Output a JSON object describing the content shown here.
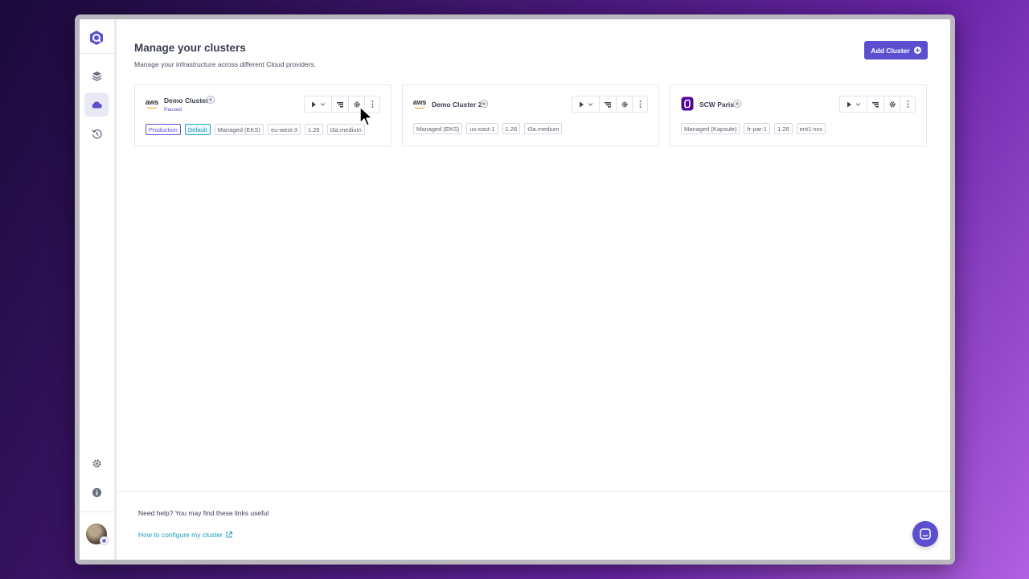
{
  "header": {
    "title": "Manage your clusters",
    "subtitle": "Manage your infrastructure across different Cloud providers.",
    "add_button_label": "Add Cluster"
  },
  "sidebar": {
    "items": [
      {
        "icon": "qovery-logo-icon"
      },
      {
        "icon": "layers-icon"
      },
      {
        "icon": "cloud-icon",
        "active": true
      },
      {
        "icon": "history-icon"
      },
      {
        "icon": "gear-icon"
      },
      {
        "icon": "info-icon"
      },
      {
        "icon": "avatar"
      }
    ]
  },
  "clusters": [
    {
      "name": "Demo Cluster",
      "provider_icon": "aws-logo-icon",
      "provider_logo_text": "aws",
      "status_text": "Paused",
      "tags": [
        "Production",
        "Default",
        "Managed (EKS)",
        "eu-west-3",
        "1.26",
        "t3a.medium"
      ]
    },
    {
      "name": "Demo Cluster 2",
      "provider_icon": "aws-logo-icon",
      "provider_logo_text": "aws",
      "tags": [
        "Managed (EKS)",
        "us-east-1",
        "1.26",
        "t3a.medium"
      ]
    },
    {
      "name": "SCW Paris",
      "provider_icon": "scaleway-logo-icon",
      "tags": [
        "Managed (Kapsule)",
        "fr-par-1",
        "1.26",
        "ent1-xxs"
      ]
    }
  ],
  "footer": {
    "help_text": "Need help? You may find these links useful",
    "link_text": "How to configure my cluster"
  },
  "colors": {
    "accent": "#5b4fd0",
    "link": "#1f9cc0",
    "default_tag": "#24a9c8"
  }
}
